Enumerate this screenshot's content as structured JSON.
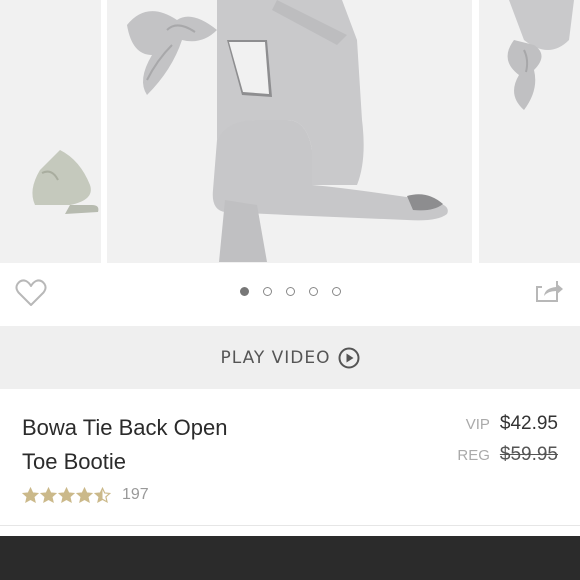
{
  "product": {
    "name_line1": "Bowa Tie Back Open",
    "name_line2": "Toe Bootie",
    "rating": 4.5,
    "rating_max": 5,
    "review_count": "197"
  },
  "pricing": {
    "vip_label": "VIP",
    "vip_price": "$42.95",
    "reg_label": "REG",
    "reg_price": "$59.95"
  },
  "video": {
    "label": "PLAY VIDEO",
    "icon": "play-circle-icon"
  },
  "carousel": {
    "slide_count": 5,
    "active_index": 0
  },
  "actions": {
    "favorite_icon": "heart-icon",
    "share_icon": "share-icon"
  },
  "colors": {
    "star": "#cbb98a",
    "suede": "#c9c9cb",
    "background_panel": "#f1f1f1",
    "video_bar": "#efefef",
    "bottom_bar": "#2b2b2b"
  }
}
